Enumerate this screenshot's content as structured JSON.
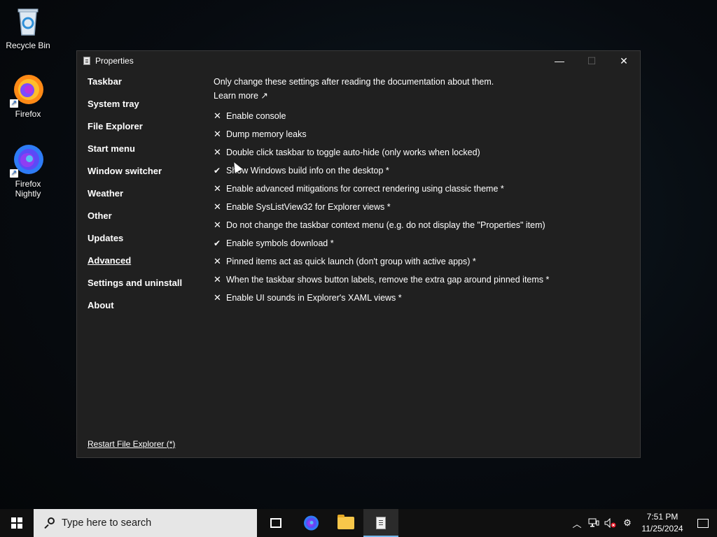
{
  "desktop": {
    "icons": [
      {
        "label": "Recycle Bin"
      },
      {
        "label": "Firefox"
      },
      {
        "label": "Firefox Nightly"
      }
    ]
  },
  "window": {
    "title": "Properties",
    "controls": {
      "minimize": "—",
      "maximize": "☐",
      "close": "✕"
    },
    "sidebar": {
      "items": [
        "Taskbar",
        "System tray",
        "File Explorer",
        "Start menu",
        "Window switcher",
        "Weather",
        "Other",
        "Updates",
        "Advanced",
        "Settings and uninstall",
        "About"
      ],
      "active": "Advanced",
      "restart_link": "Restart File Explorer (*)"
    },
    "content": {
      "notice": "Only change these settings after reading the documentation about them.",
      "learn_more": "Learn more ↗",
      "options": [
        {
          "label": "Enable console",
          "checked": false
        },
        {
          "label": "Dump memory leaks",
          "checked": false
        },
        {
          "label": "Double click taskbar to toggle auto-hide (only works when locked)",
          "checked": false
        },
        {
          "label": "Show Windows build info on the desktop *",
          "checked": true
        },
        {
          "label": "Enable advanced mitigations for correct rendering using classic theme *",
          "checked": false
        },
        {
          "label": "Enable SysListView32 for Explorer views *",
          "checked": false
        },
        {
          "label": "Do not change the taskbar context menu (e.g. do not display the \"Properties\" item)",
          "checked": false
        },
        {
          "label": "Enable symbols download *",
          "checked": true
        },
        {
          "label": "Pinned items act as quick launch (don't group with active apps) *",
          "checked": false
        },
        {
          "label": "When the taskbar shows button labels, remove the extra gap around pinned items *",
          "checked": false
        },
        {
          "label": "Enable UI sounds in Explorer's XAML views *",
          "checked": false
        }
      ],
      "marks": {
        "checked": "✔",
        "unchecked": "✕"
      }
    }
  },
  "taskbar": {
    "search_placeholder": "Type here to search",
    "clock": {
      "time": "7:51 PM",
      "date": "11/25/2024"
    },
    "tray_icons": [
      "chevron-up-icon",
      "network-icon",
      "volume-muted-icon",
      "settings-gear-icon"
    ]
  },
  "colors": {
    "window_bg": "#202020",
    "taskbar_bg": "#101010",
    "accent": "#76b9ed"
  }
}
